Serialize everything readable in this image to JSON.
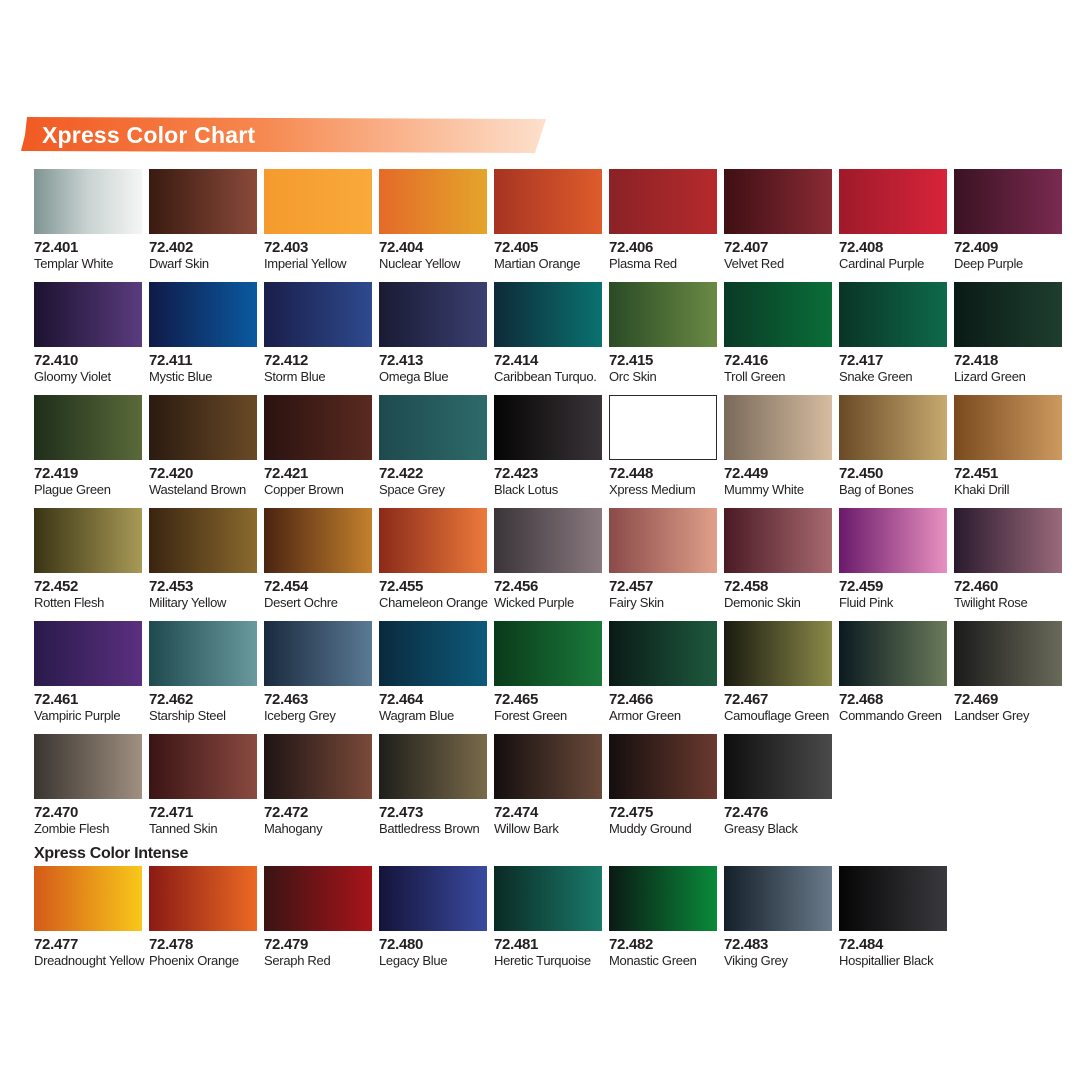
{
  "title": "Xpress Color Chart",
  "intense_title": "Xpress Color Intense",
  "accent": "#f26b2a",
  "rows": [
    [
      {
        "code": "72.401",
        "name": "Templar White",
        "colors": [
          "#7f9593",
          "#c9d3d1",
          "#f4f6f5"
        ]
      },
      {
        "code": "72.402",
        "name": "Dwarf Skin",
        "colors": [
          "#3a1a10",
          "#8a4a3a"
        ]
      },
      {
        "code": "72.403",
        "name": "Imperial Yellow",
        "colors": [
          "#f59a2e",
          "#f8aa3a"
        ]
      },
      {
        "code": "72.404",
        "name": "Nuclear Yellow",
        "colors": [
          "#e46a2a",
          "#e4a52a"
        ]
      },
      {
        "code": "72.405",
        "name": "Martian Orange",
        "colors": [
          "#a73422",
          "#de5c2c"
        ]
      },
      {
        "code": "72.406",
        "name": "Plasma Red",
        "colors": [
          "#8a2226",
          "#b52a2c"
        ]
      },
      {
        "code": "72.407",
        "name": "Velvet Red",
        "colors": [
          "#3e0f14",
          "#8a2a34"
        ]
      },
      {
        "code": "72.408",
        "name": "Cardinal Purple",
        "colors": [
          "#9e1a2a",
          "#d8243a"
        ]
      },
      {
        "code": "72.409",
        "name": "Deep Purple",
        "colors": [
          "#3a1222",
          "#7a2a50"
        ]
      }
    ],
    [
      {
        "code": "72.410",
        "name": "Gloomy Violet",
        "colors": [
          "#1c1230",
          "#5a3c7e"
        ]
      },
      {
        "code": "72.411",
        "name": "Mystic Blue",
        "colors": [
          "#101a48",
          "#0a5aa0"
        ]
      },
      {
        "code": "72.412",
        "name": "Storm Blue",
        "colors": [
          "#1a1e4a",
          "#2e4a8e"
        ]
      },
      {
        "code": "72.413",
        "name": "Omega Blue",
        "colors": [
          "#1a1a34",
          "#3a4070"
        ]
      },
      {
        "code": "72.414",
        "name": "Caribbean Turquo.",
        "colors": [
          "#0e2a38",
          "#0a7270"
        ]
      },
      {
        "code": "72.415",
        "name": "Orc Skin",
        "colors": [
          "#2a4a26",
          "#6a8a44"
        ]
      },
      {
        "code": "72.416",
        "name": "Troll Green",
        "colors": [
          "#0a3a26",
          "#0a6e38"
        ]
      },
      {
        "code": "72.417",
        "name": "Snake Green",
        "colors": [
          "#0a3426",
          "#0e6a4a"
        ]
      },
      {
        "code": "72.418",
        "name": "Lizard Green",
        "colors": [
          "#0a1a16",
          "#1e3e2e"
        ]
      }
    ],
    [
      {
        "code": "72.419",
        "name": "Plague Green",
        "colors": [
          "#1e2e1a",
          "#5a6a3a"
        ]
      },
      {
        "code": "72.420",
        "name": "Wasteland Brown",
        "colors": [
          "#2a1a10",
          "#6a4a26"
        ]
      },
      {
        "code": "72.421",
        "name": "Copper Brown",
        "colors": [
          "#2a1210",
          "#5a2a20"
        ]
      },
      {
        "code": "72.422",
        "name": "Space Grey",
        "colors": [
          "#1e4a4e",
          "#2e6a6a"
        ]
      },
      {
        "code": "72.423",
        "name": "Black Lotus",
        "colors": [
          "#050505",
          "#3a3438"
        ]
      },
      {
        "code": "72.448",
        "name": "Xpress Medium",
        "colors": [
          "#ffffff",
          "#ffffff"
        ],
        "border": true
      },
      {
        "code": "72.449",
        "name": "Mummy White",
        "colors": [
          "#7a6a5a",
          "#d6bca0"
        ]
      },
      {
        "code": "72.450",
        "name": "Bag of Bones",
        "colors": [
          "#6a4a26",
          "#c6aa70"
        ]
      },
      {
        "code": "72.451",
        "name": "Khaki Drill",
        "colors": [
          "#7a4a1e",
          "#cc9a60"
        ]
      }
    ],
    [
      {
        "code": "72.452",
        "name": "Rotten Flesh",
        "colors": [
          "#3a3414",
          "#a89a56"
        ]
      },
      {
        "code": "72.453",
        "name": "Military Yellow",
        "colors": [
          "#3a2410",
          "#8a6a2e"
        ]
      },
      {
        "code": "72.454",
        "name": "Desert Ochre",
        "colors": [
          "#4a2410",
          "#c4802e"
        ]
      },
      {
        "code": "72.455",
        "name": "Chameleon Orange",
        "colors": [
          "#8a2a1a",
          "#ec7a3a"
        ]
      },
      {
        "code": "72.456",
        "name": "Wicked Purple",
        "colors": [
          "#3a3438",
          "#8a7a80"
        ]
      },
      {
        "code": "72.457",
        "name": "Fairy Skin",
        "colors": [
          "#8a4a4a",
          "#e0a08a"
        ]
      },
      {
        "code": "72.458",
        "name": "Demonic Skin",
        "colors": [
          "#4a1a24",
          "#a86a70"
        ]
      },
      {
        "code": "72.459",
        "name": "Fluid Pink",
        "colors": [
          "#6a1a6a",
          "#e890c0"
        ]
      },
      {
        "code": "72.460",
        "name": "Twilight Rose",
        "colors": [
          "#2a1a2e",
          "#9a6a7a"
        ]
      }
    ],
    [
      {
        "code": "72.461",
        "name": "Vampiric Purple",
        "colors": [
          "#2a1a4a",
          "#5a3080"
        ]
      },
      {
        "code": "72.462",
        "name": "Starship Steel",
        "colors": [
          "#1e4a4e",
          "#6a9a9e"
        ]
      },
      {
        "code": "72.463",
        "name": "Iceberg Grey",
        "colors": [
          "#1a2a3e",
          "#5a7a94"
        ]
      },
      {
        "code": "72.464",
        "name": "Wagram Blue",
        "colors": [
          "#0a2a3e",
          "#0e5a7a"
        ]
      },
      {
        "code": "72.465",
        "name": "Forest Green",
        "colors": [
          "#0a3a1a",
          "#1a7a3a"
        ]
      },
      {
        "code": "72.466",
        "name": "Armor Green",
        "colors": [
          "#0a1a16",
          "#1e5a3e"
        ]
      },
      {
        "code": "72.467",
        "name": "Camouflage Green",
        "colors": [
          "#1a1a10",
          "#8a8a4a"
        ]
      },
      {
        "code": "72.468",
        "name": "Commando Green",
        "colors": [
          "#0a1a20",
          "#6a7a5a"
        ]
      },
      {
        "code": "72.469",
        "name": "Landser Grey",
        "colors": [
          "#1a1a1a",
          "#6a6a5a"
        ]
      }
    ],
    [
      {
        "code": "72.470",
        "name": "Zombie Flesh",
        "colors": [
          "#3a3430",
          "#a09080"
        ]
      },
      {
        "code": "72.471",
        "name": "Tanned Skin",
        "colors": [
          "#3a1414",
          "#8a4a40"
        ]
      },
      {
        "code": "72.472",
        "name": "Mahogany",
        "colors": [
          "#1e1414",
          "#7a4a3a"
        ]
      },
      {
        "code": "72.473",
        "name": "Battledress Brown",
        "colors": [
          "#1e1e1a",
          "#7a6a4a"
        ]
      },
      {
        "code": "72.474",
        "name": "Willow Bark",
        "colors": [
          "#140e0e",
          "#6a4a3a"
        ]
      },
      {
        "code": "72.475",
        "name": "Muddy Ground",
        "colors": [
          "#140e0e",
          "#6a3a2e"
        ]
      },
      {
        "code": "72.476",
        "name": "Greasy Black",
        "colors": [
          "#0e0e0e",
          "#4a4a4a"
        ]
      }
    ],
    [
      {
        "code": "72.477",
        "name": "Dreadnought Yellow",
        "colors": [
          "#d45a1a",
          "#f8c81a"
        ]
      },
      {
        "code": "72.478",
        "name": "Phoenix Orange",
        "colors": [
          "#8a1a14",
          "#ec6a24"
        ]
      },
      {
        "code": "72.479",
        "name": "Seraph Red",
        "colors": [
          "#3a1414",
          "#a8141a"
        ]
      },
      {
        "code": "72.480",
        "name": "Legacy Blue",
        "colors": [
          "#14143a",
          "#3a4aa0"
        ]
      },
      {
        "code": "72.481",
        "name": "Heretic Turquoise",
        "colors": [
          "#0a2a24",
          "#1a7a6a"
        ]
      },
      {
        "code": "72.482",
        "name": "Monastic Green",
        "colors": [
          "#0a1a14",
          "#0a8a3a"
        ]
      },
      {
        "code": "72.483",
        "name": "Viking Grey",
        "colors": [
          "#14202a",
          "#6a7a8a"
        ]
      },
      {
        "code": "72.484",
        "name": "Hospitallier Black",
        "colors": [
          "#050505",
          "#3a3a3e"
        ]
      }
    ]
  ]
}
